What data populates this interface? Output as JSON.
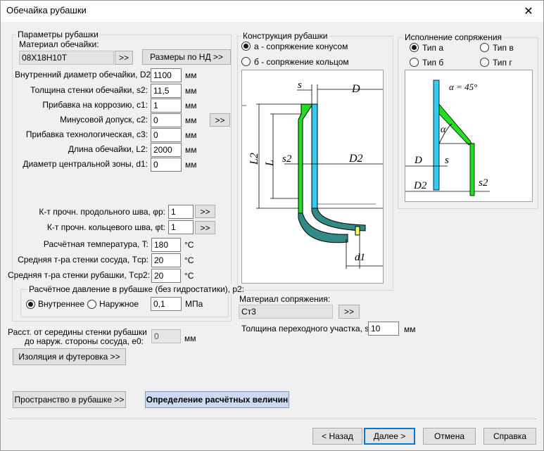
{
  "window": {
    "title": "Обечайка рубашки",
    "close_glyph": "✕"
  },
  "params": {
    "legend": "Параметры рубашки",
    "material_label": "Материал обечайки:",
    "material_value": "08Х18Н10Т",
    "material_btn": ">>",
    "nd_btn": "Размеры по НД >>",
    "fields": [
      {
        "label": "Внутренний диаметр обечайки, D2:",
        "value": "1100",
        "unit": "мм"
      },
      {
        "label": "Толщина стенки обечайки, s2:",
        "value": "11,5",
        "unit": "мм"
      },
      {
        "label": "Прибавка на коррозию, c1:",
        "value": "1",
        "unit": "мм"
      },
      {
        "label": "Минусовой допуск, c2:",
        "value": "0",
        "unit": "мм"
      },
      {
        "label": "Прибавка технологическая, c3:",
        "value": "0",
        "unit": "мм"
      },
      {
        "label": "Длина обечайки, L2:",
        "value": "2000",
        "unit": "мм"
      },
      {
        "label": "Диаметр центральной зоны, d1:",
        "value": "0",
        "unit": "мм"
      }
    ],
    "tolerance_btn": ">>",
    "phi_long_label": "К-т прочн. продольного шва, φр:",
    "phi_long_value": "1",
    "phi_circ_label": "К-т прочн. кольцевого шва, φt:",
    "phi_circ_value": "1",
    "phi_btn": ">>",
    "temps": [
      {
        "label": "Расчётная температура, T:",
        "value": "180",
        "unit": "°С"
      },
      {
        "label": "Средняя т-ра стенки сосуда, Tср:",
        "value": "20",
        "unit": "°С"
      },
      {
        "label": "Средняя т-ра стенки рубашки, Tср2:",
        "value": "20",
        "unit": "°С"
      }
    ],
    "pressure_legend": "Расчётное давление в рубашке (без гидростатики), p2:",
    "pressure_internal": "Внутреннее",
    "pressure_external": "Наружное",
    "pressure_value": "0,1",
    "pressure_unit": "МПа",
    "pressure_selected": "Внутреннее"
  },
  "distance": {
    "label_line1": "Расст. от середины стенки рубашки",
    "label_line2": "до наруж. стороны сосуда, e0:",
    "value": "0",
    "unit": "мм"
  },
  "insulation_btn": "Изоляция и футеровка >>",
  "space_btn": "Пространство в рубашке >>",
  "calc_btn": "Определение расчётных величин",
  "construction": {
    "legend": "Конструкция рубашки",
    "option_a": "а - сопряжение конусом",
    "option_b": "б - сопряжение кольцом",
    "selected": "а",
    "labels": {
      "s": "s",
      "D": "D",
      "L2": "L2",
      "L": "L",
      "s2": "s2",
      "D2": "D2",
      "d1": "d1"
    }
  },
  "joint": {
    "legend": "Исполнение сопряжения",
    "types": [
      "Тип а",
      "Тип в",
      "Тип б",
      "Тип г"
    ],
    "selected": "Тип а",
    "labels": {
      "alpha_eq": "α = 45°",
      "alpha": "α",
      "D": "D",
      "s": "s",
      "D2": "D2",
      "s2": "s2"
    }
  },
  "joint_material": {
    "label": "Материал сопряжения:",
    "value": "Ст3",
    "btn": ">>",
    "thickness_label": "Толщина переходного участка, sR:",
    "thickness_value": "10",
    "thickness_unit": "мм"
  },
  "footer": {
    "back": "< Назад",
    "next": "Далее >",
    "cancel": "Отмена",
    "help": "Справка"
  },
  "colors": {
    "jacket_green": "#22dd22",
    "vessel_cyan": "#33ccee",
    "bottom_teal": "#338888",
    "accent_blue": "#0078d7"
  }
}
